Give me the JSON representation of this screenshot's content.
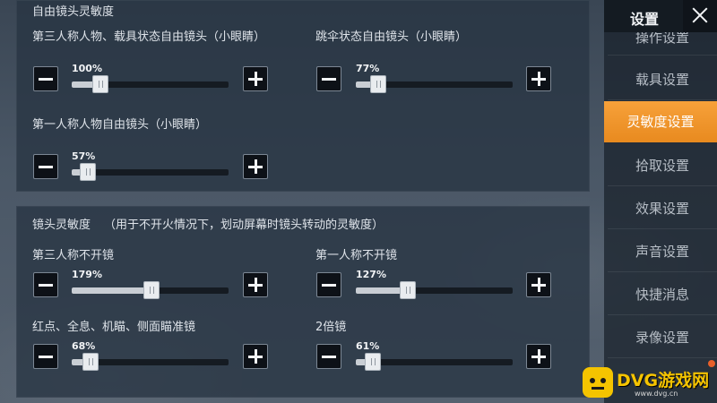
{
  "sidebar": {
    "title": "设置",
    "items": [
      {
        "label": "操作设置",
        "active": false
      },
      {
        "label": "载具设置",
        "active": false
      },
      {
        "label": "灵敏度设置",
        "active": true
      },
      {
        "label": "拾取设置",
        "active": false
      },
      {
        "label": "效果设置",
        "active": false
      },
      {
        "label": "声音设置",
        "active": false
      },
      {
        "label": "快捷消息",
        "active": false
      },
      {
        "label": "录像设置",
        "active": false
      }
    ]
  },
  "free_look": {
    "title": "自由镜头灵敏度",
    "sliders": [
      {
        "label": "第三人称人物、载具状态自由镜头（小眼睛）",
        "value_text": "100%",
        "level": 0.18
      },
      {
        "label": "跳伞状态自由镜头（小眼睛）",
        "value_text": "77%",
        "level": 0.14
      },
      {
        "label": "第一人称人物自由镜头（小眼睛）",
        "value_text": "57%",
        "level": 0.1
      }
    ]
  },
  "lens": {
    "title": "镜头灵敏度",
    "subtitle": "（用于不开火情况下，划动屏幕时镜头转动的灵敏度）",
    "sliders": [
      {
        "label": "第三人称不开镜",
        "value_text": "179%",
        "level": 0.51
      },
      {
        "label": "第一人称不开镜",
        "value_text": "127%",
        "level": 0.33
      },
      {
        "label": "红点、全息、机瞄、侧面瞄准镜",
        "value_text": "68%",
        "level": 0.12
      },
      {
        "label": "2倍镜",
        "value_text": "61%",
        "level": 0.11
      }
    ]
  },
  "watermark": {
    "brand": "DVG游戏网",
    "url": "www.dvg.cn"
  },
  "colors": {
    "accent": "#f29a2e",
    "watermark": "#f5c400"
  }
}
